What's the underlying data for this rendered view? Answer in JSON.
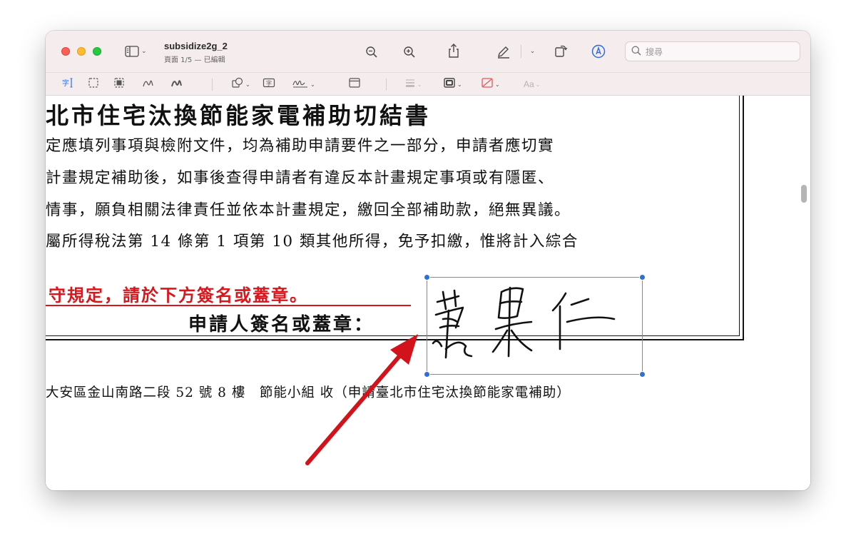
{
  "window": {
    "doc_title": "subsidize2g_2",
    "doc_subtitle": "頁面 1/5 — 已編輯"
  },
  "toolbar": {
    "sidebar_icon": "sidebar-icon",
    "zoom_out_icon": "zoom-out-icon",
    "zoom_in_icon": "zoom-in-icon",
    "share_icon": "share-icon",
    "highlight_icon": "highlight-pen-icon",
    "rotate_icon": "rotate-icon",
    "markup_icon": "markup-icon",
    "search_placeholder": "搜尋"
  },
  "markup": {
    "tools": [
      "text-selection-icon",
      "rectangular-selection-icon",
      "redact-icon",
      "sketch-icon",
      "draw-icon",
      "shapes-icon",
      "text-box-icon",
      "sign-icon",
      "note-icon",
      "line-style-icon",
      "border-color-icon",
      "fill-color-icon"
    ],
    "text_style_label": "Aa"
  },
  "document": {
    "heading": "北市住宅汰換節能家電補助切結書",
    "lines": [
      "定應填列事項與檢附文件，均為補助申請要件之一部分，申請者應切實",
      "計畫規定補助後，如事後查得申請者有違反本計畫規定事項或有隱匿、",
      "情事，願負相關法律責任並依本計畫規定，繳回全部補助款，絕無異議。",
      "屬所得稅法第 14 條第 1 項第 10 類其他所得，免予扣繳，惟將計入綜合"
    ],
    "red_notice": "守規定，請於下方簽名或蓋章。",
    "sign_label": "申請人簽名或蓋章：",
    "footer": "大安區金山南路二段 52 號 8 樓　節能小組 收（申請臺北市住宅汰換節能家電補助）",
    "signature_glyphs": "葉果仁"
  },
  "colors": {
    "notice_red": "#d9161c",
    "handle_blue": "#2f6fd6",
    "arrow_red": "#d3131b",
    "titlebar_bg": "#f5ecee"
  }
}
